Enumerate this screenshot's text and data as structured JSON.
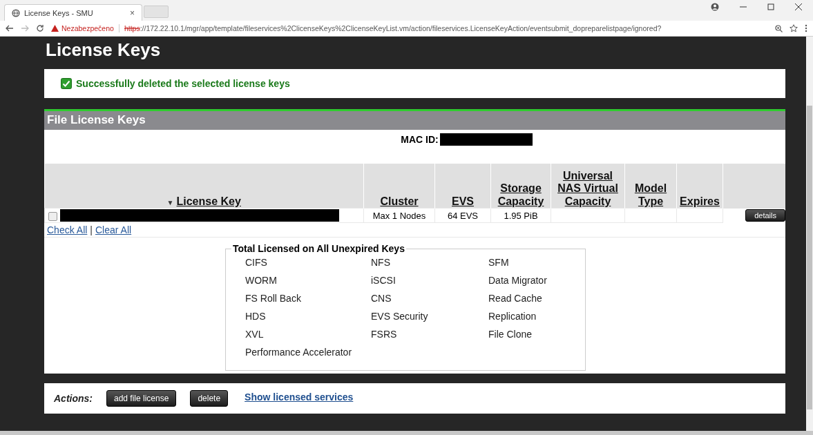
{
  "browser": {
    "tab_title": "License Keys - SMU",
    "tab_close": "×",
    "security": "Nezabezpečeno",
    "url_scheme": "https",
    "url_rest": "://172.22.10.1/mgr/app/template/fileservices%2ClicenseKeys%2ClicenseKeyList.vm/action/fileservices.LicenseKeyAction/eventsubmit_dopreparelistpage/ignored?"
  },
  "page_title": "License Keys",
  "message": {
    "kind": "success",
    "text": "Successfully deleted the selected license keys"
  },
  "panel": {
    "title": "File License Keys",
    "mac_label": "MAC ID:",
    "mac_redacted": true
  },
  "table": {
    "sort_indicator": "▼",
    "columns": [
      "License Key",
      "Cluster",
      "EVS",
      "Storage Capacity",
      "Universal NAS Virtual Capacity",
      "Model Type",
      "Expires"
    ],
    "rows": [
      {
        "checked": false,
        "key_redacted": true,
        "cluster": "Max 1 Nodes",
        "evs": "64 EVS",
        "storage": "1.95 PiB",
        "universal": "",
        "model": "",
        "expires": "",
        "button": "details"
      }
    ]
  },
  "check_all": "Check All",
  "separator": "|",
  "clear_all": "Clear All",
  "totals": {
    "legend": "Total Licensed on All Unexpired Keys",
    "services": [
      "CIFS",
      "NFS",
      "SFM",
      "WORM",
      "iSCSI",
      "Data Migrator",
      "FS Roll Back",
      "CNS",
      "Read Cache",
      "HDS",
      "EVS Security",
      "Replication",
      "XVL",
      "FSRS",
      "File Clone",
      "Performance Accelerator"
    ]
  },
  "actions": {
    "label": "Actions:",
    "buttons": [
      "add file license",
      "delete"
    ],
    "link": "Show licensed services"
  }
}
